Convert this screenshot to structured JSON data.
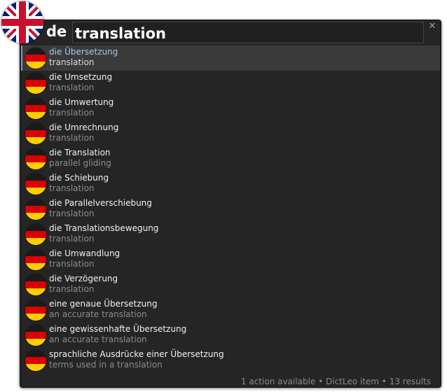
{
  "query": {
    "language_code": "de",
    "text": "translation",
    "source_flag_icon": "uk-flag-icon"
  },
  "result_flag_icon": "germany-flag-icon",
  "results": [
    {
      "title": "die Übersetzung",
      "subtitle": "translation",
      "selected": true
    },
    {
      "title": "die Umsetzung",
      "subtitle": "translation"
    },
    {
      "title": "die Umwertung",
      "subtitle": "translation"
    },
    {
      "title": "die Umrechnung",
      "subtitle": "translation"
    },
    {
      "title": "die Translation",
      "subtitle": "parallel gliding"
    },
    {
      "title": "die Schiebung",
      "subtitle": "translation"
    },
    {
      "title": "die Parallelverschiebung",
      "subtitle": "translation"
    },
    {
      "title": "die Translationsbewegung",
      "subtitle": "translation"
    },
    {
      "title": "die Umwandlung",
      "subtitle": "translation"
    },
    {
      "title": "die Verzögerung",
      "subtitle": "translation"
    },
    {
      "title": "eine genaue Übersetzung",
      "subtitle": "an accurate translation"
    },
    {
      "title": "eine gewissenhafte Übersetzung",
      "subtitle": "an accurate translation"
    },
    {
      "title": "sprachliche Ausdrücke einer Übersetzung",
      "subtitle": "terms used in a translation"
    }
  ],
  "status": "1 action available • DictLeo item • 13 results",
  "colors": {
    "panel_bg": "#252525",
    "selected_bg": "#3a3a3a",
    "selected_title": "#a9c9ea",
    "title": "#f2f2f2",
    "subtitle": "#8c8c8c"
  }
}
